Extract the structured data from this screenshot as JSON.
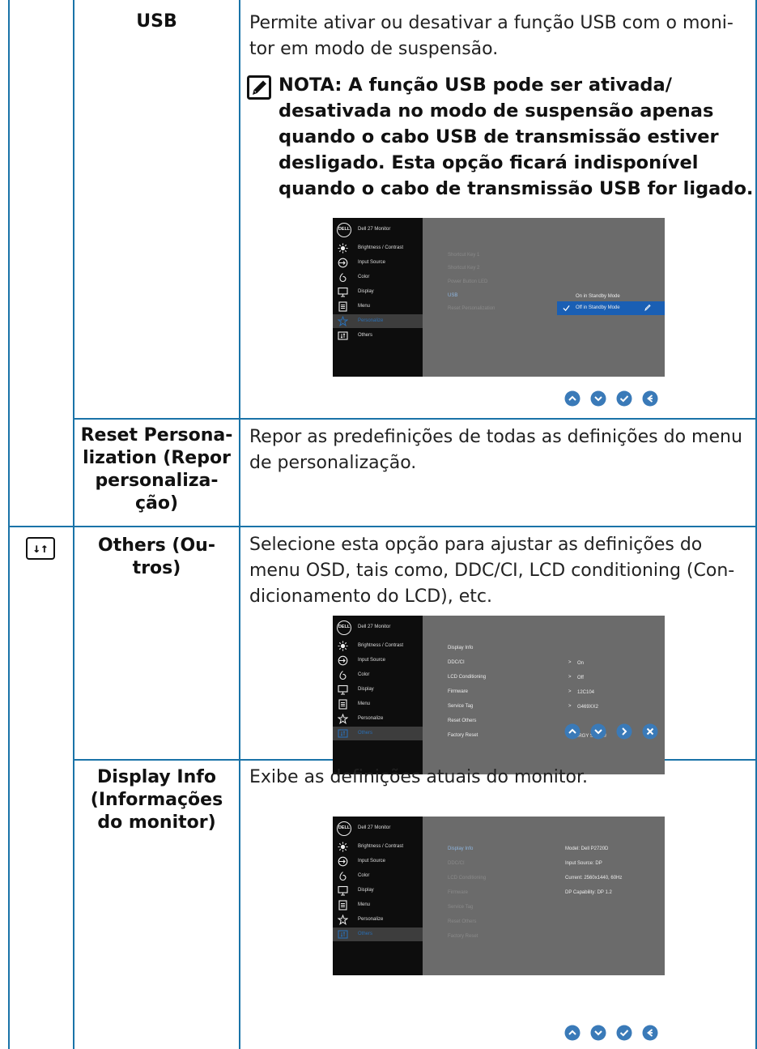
{
  "rows": {
    "usb": {
      "label": "USB",
      "desc_lines": [
        "Permite ativar ou desativar a função USB com o moni-",
        "tor em modo de suspensão."
      ],
      "note_lines": [
        "NOTA: A função USB pode ser ativada/",
        "desativada no modo de suspensão apenas",
        "quando o cabo USB de transmissão estiver",
        "desligado. Esta opção ficará indisponível",
        "quando o cabo de transmissão USB for ligado."
      ],
      "note_icon": "pencil-note-icon"
    },
    "reset_personalization": {
      "label_lines": [
        "Reset Persona-",
        "lization (Repor",
        "personaliza-",
        "ção)"
      ],
      "desc_lines": [
        "Repor as predefinições de todas as definições do menu",
        "de personalização."
      ]
    },
    "others": {
      "icon": "others-sliders-icon",
      "icon_glyph": "↓↑",
      "label_lines": [
        "Others (Ou-",
        "tros)"
      ],
      "desc_lines": [
        "Selecione esta opção para ajustar as definições do",
        "menu OSD, tais como, DDC/CI, LCD conditioning (Con-",
        "dicionamento do LCD), etc."
      ]
    },
    "display_info": {
      "label_lines": [
        "Display Info",
        "(Informações",
        "do monitor)"
      ],
      "desc_lines": [
        "Exibe as definições atuais do monitor."
      ]
    }
  },
  "osd_common": {
    "logo": "DELL",
    "title": "Dell 27 Monitor",
    "menu": [
      {
        "label": "Brightness / Contrast",
        "icon": "brightness-icon"
      },
      {
        "label": "Input Source",
        "icon": "input-source-icon"
      },
      {
        "label": "Color",
        "icon": "color-icon"
      },
      {
        "label": "Display",
        "icon": "display-icon"
      },
      {
        "label": "Menu",
        "icon": "menu-icon"
      },
      {
        "label": "Personalize",
        "icon": "personalize-star-icon"
      },
      {
        "label": "Others",
        "icon": "others-icon"
      }
    ]
  },
  "osd_personalize": {
    "active_menu": "Personalize",
    "options": [
      "Shortcut Key 1",
      "Shortcut Key 2",
      "Power Button LED",
      "USB",
      "Reset Personalization"
    ],
    "values": [
      "On in Standby Mode",
      "Off in Standby Mode"
    ]
  },
  "osd_others": {
    "active_menu": "Others",
    "options": [
      "Display Info",
      "DDC/CI",
      "LCD Conditioning",
      "Firmware",
      "Service Tag",
      "Reset Others",
      "Factory Reset"
    ],
    "values": [
      "On",
      "Off",
      "12C104",
      "G469XX2",
      "ENERGY STAR®"
    ]
  },
  "osd_display_info": {
    "active_menu": "Others",
    "options": [
      "Display Info",
      "DDC/CI",
      "LCD Conditioning",
      "Firmware",
      "Service Tag",
      "Reset Others",
      "Factory Reset"
    ],
    "info": [
      "Model: Dell P2720D",
      "Input Source: DP",
      "Current: 2560x1440, 60Hz",
      "DP Capability: DP 1.2"
    ]
  },
  "nav_buttons": {
    "set1": [
      "up-icon",
      "down-icon",
      "check-icon",
      "back-icon"
    ],
    "set2": [
      "up-icon",
      "down-icon",
      "right-icon",
      "close-icon"
    ],
    "set3": [
      "up-icon",
      "down-icon",
      "check-icon",
      "back-icon"
    ]
  },
  "colors": {
    "rule": "#1a73a8",
    "osd_bg": "#6b6b6b",
    "osd_side": "#0d0d0d",
    "highlight": "#1a5fb4"
  }
}
